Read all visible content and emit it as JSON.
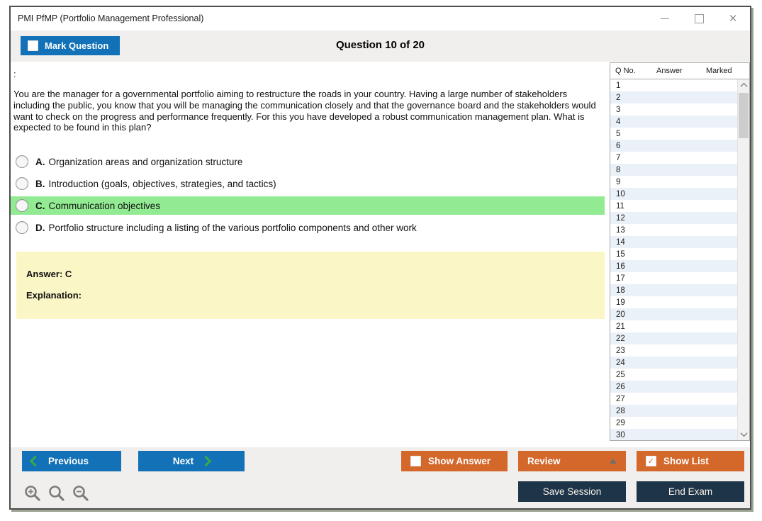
{
  "window": {
    "title": "PMI PfMP (Portfolio Management Professional)"
  },
  "toolbar": {
    "mark_question_label": "Mark Question",
    "question_counter": "Question 10 of 20"
  },
  "question": {
    "prefix": ":",
    "text": "You are the manager for a governmental portfolio aiming to restructure the roads in your country. Having a large number of stakeholders including the public, you know that you will be managing the communication closely and that the governance board and the stakeholders would want to check on the progress and performance frequently. For this you have developed a robust communication management plan. What is expected to be found in this plan?"
  },
  "options": [
    {
      "letter": "A.",
      "text": "Organization areas and organization structure",
      "highlighted": false
    },
    {
      "letter": "B.",
      "text": "Introduction (goals, objectives, strategies, and tactics)",
      "highlighted": false
    },
    {
      "letter": "C.",
      "text": "Communication objectives",
      "highlighted": true
    },
    {
      "letter": "D.",
      "text": "Portfolio structure including a listing of the various portfolio components and other work",
      "highlighted": false
    }
  ],
  "answer_panel": {
    "answer": "Answer: C",
    "explanation": "Explanation:"
  },
  "sidebar": {
    "columns": [
      "Q No.",
      "Answer",
      "Marked"
    ],
    "rows": [
      {
        "q": "1",
        "answer": "",
        "marked": ""
      },
      {
        "q": "2",
        "answer": "",
        "marked": ""
      },
      {
        "q": "3",
        "answer": "",
        "marked": ""
      },
      {
        "q": "4",
        "answer": "",
        "marked": ""
      },
      {
        "q": "5",
        "answer": "",
        "marked": ""
      },
      {
        "q": "6",
        "answer": "",
        "marked": ""
      },
      {
        "q": "7",
        "answer": "",
        "marked": ""
      },
      {
        "q": "8",
        "answer": "",
        "marked": ""
      },
      {
        "q": "9",
        "answer": "",
        "marked": ""
      },
      {
        "q": "10",
        "answer": "",
        "marked": ""
      },
      {
        "q": "11",
        "answer": "",
        "marked": ""
      },
      {
        "q": "12",
        "answer": "",
        "marked": ""
      },
      {
        "q": "13",
        "answer": "",
        "marked": ""
      },
      {
        "q": "14",
        "answer": "",
        "marked": ""
      },
      {
        "q": "15",
        "answer": "",
        "marked": ""
      },
      {
        "q": "16",
        "answer": "",
        "marked": ""
      },
      {
        "q": "17",
        "answer": "",
        "marked": ""
      },
      {
        "q": "18",
        "answer": "",
        "marked": ""
      },
      {
        "q": "19",
        "answer": "",
        "marked": ""
      },
      {
        "q": "20",
        "answer": "",
        "marked": ""
      },
      {
        "q": "21",
        "answer": "",
        "marked": ""
      },
      {
        "q": "22",
        "answer": "",
        "marked": ""
      },
      {
        "q": "23",
        "answer": "",
        "marked": ""
      },
      {
        "q": "24",
        "answer": "",
        "marked": ""
      },
      {
        "q": "25",
        "answer": "",
        "marked": ""
      },
      {
        "q": "26",
        "answer": "",
        "marked": ""
      },
      {
        "q": "27",
        "answer": "",
        "marked": ""
      },
      {
        "q": "28",
        "answer": "",
        "marked": ""
      },
      {
        "q": "29",
        "answer": "",
        "marked": ""
      },
      {
        "q": "30",
        "answer": "",
        "marked": ""
      }
    ]
  },
  "footer": {
    "previous": "Previous",
    "next": "Next",
    "show_answer": "Show Answer",
    "review": "Review",
    "show_list": "Show List",
    "save_session": "Save Session",
    "end_exam": "End Exam"
  },
  "colors": {
    "accent_blue": "#1271b7",
    "accent_orange": "#d4672a",
    "accent_navy": "#1e3448",
    "highlight_green": "#92eb92",
    "answer_yellow": "#faf6c5",
    "row_stripe_blue": "#ebf1f8",
    "chevron_green": "#3aaa46"
  }
}
